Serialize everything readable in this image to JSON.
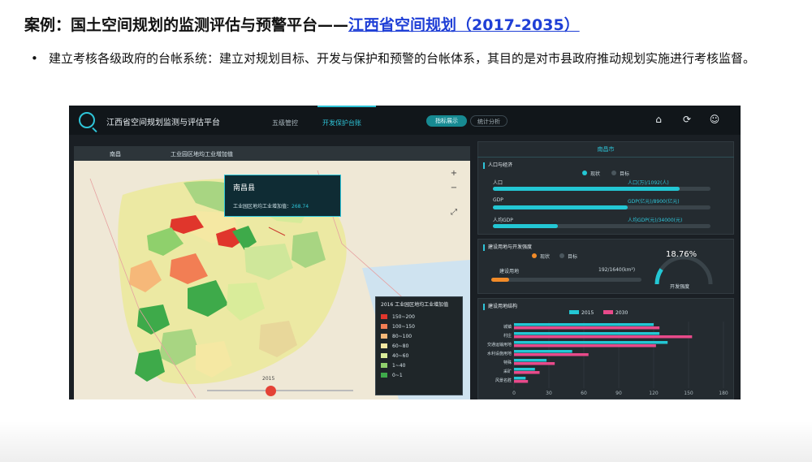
{
  "slide": {
    "title_prefix": "案例：国土空间规划的监测评估与预警平台——",
    "title_link": "江西省空间规划（2017-2035）",
    "bullet_symbol": "•",
    "bullet_text": "建立考核各级政府的台帐系统：建立对规划目标、开发与保护和预警的台帐体系，其目的是对市县政府推动规划实施进行考核监督。"
  },
  "dashboard": {
    "app_title": "江西省空间规划监测与评估平台",
    "nav": [
      "五级管控",
      "开发保护台账"
    ],
    "toggle": [
      "指标展示",
      "统计分析"
    ],
    "icons": [
      "home-icon",
      "refresh-icon",
      "user-icon"
    ],
    "map": {
      "select1": "南昌",
      "select2": "工业园区地均工业增加值",
      "tooltip_title": "南昌县",
      "tooltip_label": "工业园区地均工业增加值：",
      "tooltip_value": "268.74",
      "timeline_year": "2015",
      "legend_title": "2016 工业园区地均工业增加值",
      "legend": [
        {
          "label": "150~200",
          "color": "#e0362c"
        },
        {
          "label": "100~150",
          "color": "#f27e54"
        },
        {
          "label": "80~100",
          "color": "#f6b879"
        },
        {
          "label": "60~80",
          "color": "#f5e8a3"
        },
        {
          "label": "40~60",
          "color": "#d9ec9a"
        },
        {
          "label": "1~40",
          "color": "#8fd06c"
        },
        {
          "label": "0~1",
          "color": "#3eaa4a"
        }
      ]
    },
    "right": {
      "city": "南昌市",
      "panel1_title": "人口与经济",
      "legend_now": "现状",
      "legend_target": "目标",
      "metrics": [
        {
          "label": "人口",
          "value": "人口(万)/1092(人)",
          "fill": 0.86
        },
        {
          "label": "GDP",
          "value": "GDP(亿元)/8900(亿元)",
          "fill": 0.62
        },
        {
          "label": "人均GDP",
          "value": "人均GDP(元)/34000(元)",
          "fill": 0.3
        }
      ],
      "panel2_title": "建设用地与开发强度",
      "land_label": "建设用地",
      "land_value": "192/1640(km²)",
      "land_fill": 0.12,
      "gauge_value": "18.76%",
      "gauge_percent": 18.76,
      "gauge_label": "开发强度",
      "panel3_title": "建设用地结构",
      "chart_data": {
        "type": "bar",
        "orientation": "horizontal",
        "categories": [
          "城镇",
          "村庄",
          "交通运输用地",
          "水利设施用地",
          "特殊",
          "采矿",
          "风景名胜"
        ],
        "series": [
          {
            "name": "2015",
            "color": "#23c7d4",
            "values": [
              120,
              125,
              132,
              50,
              28,
              18,
              10
            ]
          },
          {
            "name": "2030",
            "color": "#e84a8a",
            "values": [
              125,
              153,
              122,
              64,
              35,
              22,
              12
            ]
          }
        ],
        "xticks": [
          "0",
          "30",
          "60",
          "90",
          "120",
          "150",
          "180"
        ],
        "xlim": [
          0,
          180
        ]
      }
    }
  }
}
